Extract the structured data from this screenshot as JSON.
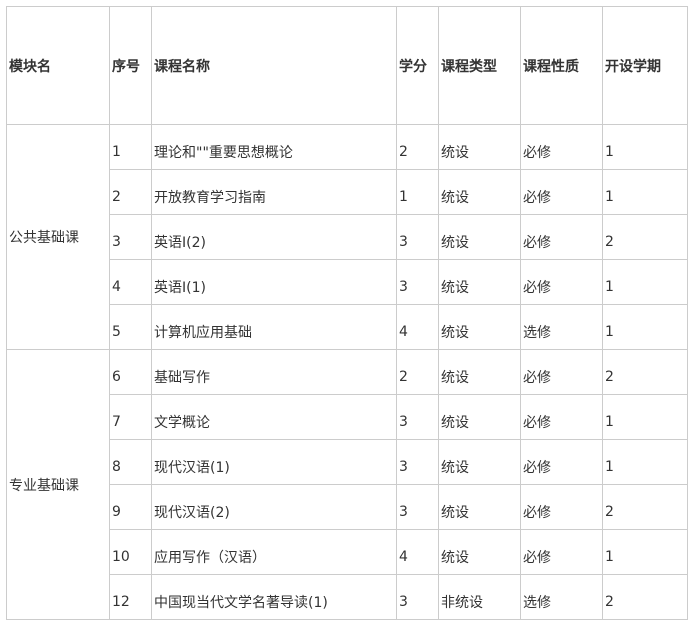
{
  "header": {
    "module": "模块名",
    "seq": "序号",
    "name": "课程名称",
    "credit": "学分",
    "type": "课程类型",
    "nature": "课程性质",
    "term": "开设学期"
  },
  "groups": [
    {
      "module": "公共基础课",
      "rows": [
        {
          "seq": "1",
          "name": "理论和\"\"重要思想概论",
          "credit": "2",
          "type": "统设",
          "nature": "必修",
          "term": "1"
        },
        {
          "seq": "2",
          "name": "开放教育学习指南",
          "credit": "1",
          "type": "统设",
          "nature": "必修",
          "term": "1"
        },
        {
          "seq": "3",
          "name": "英语Ⅰ(2)",
          "credit": "3",
          "type": "统设",
          "nature": "必修",
          "term": "2"
        },
        {
          "seq": "4",
          "name": "英语Ⅰ(1)",
          "credit": "3",
          "type": "统设",
          "nature": "必修",
          "term": "1"
        },
        {
          "seq": "5",
          "name": "计算机应用基础",
          "credit": "4",
          "type": "统设",
          "nature": "选修",
          "term": "1"
        }
      ]
    },
    {
      "module": "专业基础课",
      "rows": [
        {
          "seq": "6",
          "name": "基础写作",
          "credit": "2",
          "type": "统设",
          "nature": "必修",
          "term": "2"
        },
        {
          "seq": "7",
          "name": "文学概论",
          "credit": "3",
          "type": "统设",
          "nature": "必修",
          "term": "1"
        },
        {
          "seq": "8",
          "name": "现代汉语(1)",
          "credit": "3",
          "type": "统设",
          "nature": "必修",
          "term": "1"
        },
        {
          "seq": "9",
          "name": "现代汉语(2)",
          "credit": "3",
          "type": "统设",
          "nature": "必修",
          "term": "2"
        },
        {
          "seq": "10",
          "name": "应用写作（汉语）",
          "credit": "4",
          "type": "统设",
          "nature": "必修",
          "term": "1"
        },
        {
          "seq": "12",
          "name": "中国现当代文学名著导读(1)",
          "credit": "3",
          "type": "非统设",
          "nature": "选修",
          "term": "2"
        }
      ]
    }
  ]
}
